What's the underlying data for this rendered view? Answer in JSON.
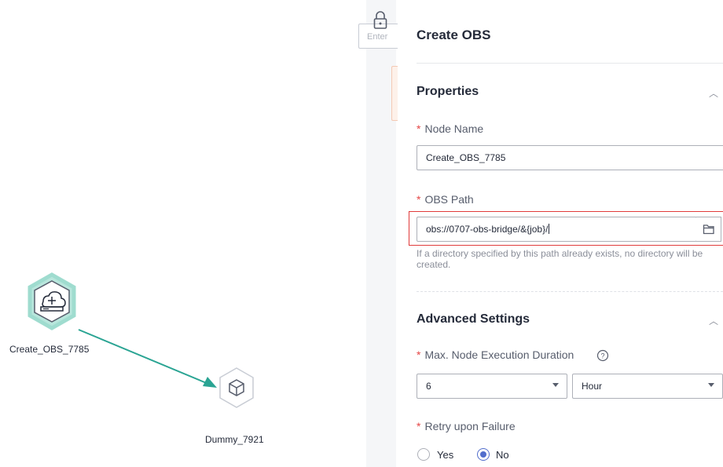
{
  "canvas": {
    "nodes": [
      {
        "label": "Create_OBS_7785",
        "icon": "cloud-plus-icon"
      },
      {
        "label": "Dummy_7921",
        "icon": "cube-icon"
      }
    ],
    "edge_color": "#2aa493"
  },
  "toolbar": {
    "search_placeholder": "Enter"
  },
  "panel": {
    "title": "Create OBS",
    "properties": {
      "section_title": "Properties",
      "node_name_label": "Node Name",
      "node_name_value": "Create_OBS_7785",
      "obs_path_label": "OBS Path",
      "obs_path_value": "obs://0707-obs-bridge/&{job}/",
      "obs_path_help": "If a directory specified by this path already exists, no directory will be created."
    },
    "advanced": {
      "section_title": "Advanced Settings",
      "max_duration_label": "Max. Node Execution Duration",
      "max_duration_value": "6",
      "max_duration_unit": "Hour",
      "retry_label": "Retry upon Failure",
      "retry_options": [
        "Yes",
        "No"
      ],
      "retry_selected": "No"
    }
  },
  "colors": {
    "accent": "#526ecc",
    "required": "#e54545",
    "highlight_border": "#e03b3b",
    "node_ring": "#9fdccf"
  }
}
